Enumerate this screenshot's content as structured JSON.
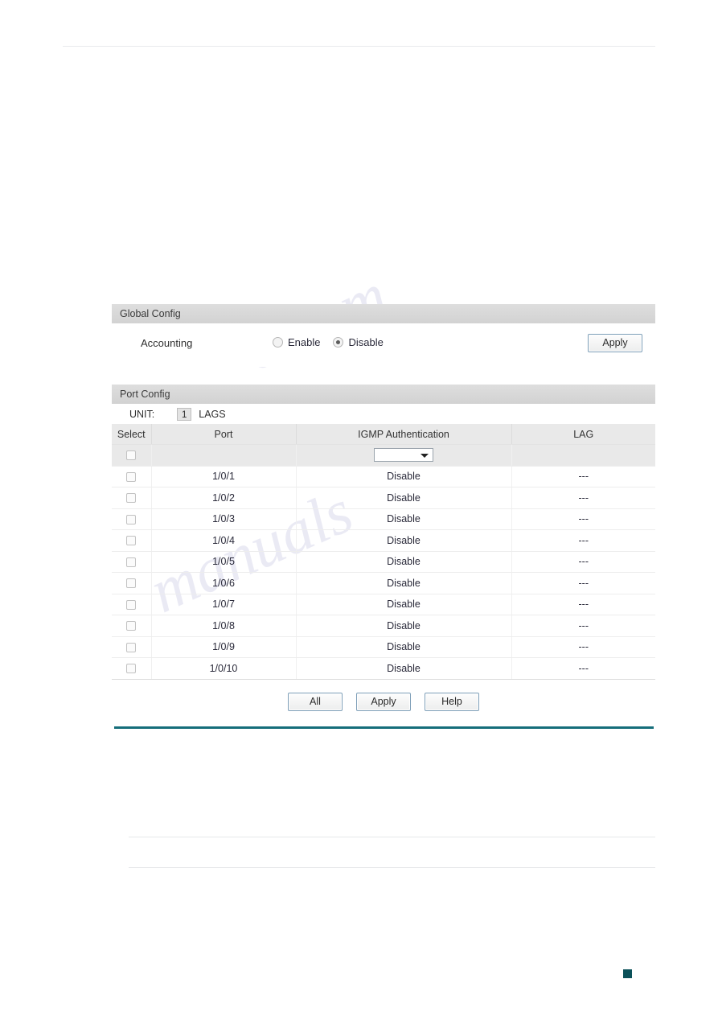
{
  "watermark": {
    "line1": "e.com",
    "line2": "manuals"
  },
  "global_config": {
    "title": "Global Config",
    "accounting_label": "Accounting",
    "options": [
      {
        "label": "Enable",
        "selected": false
      },
      {
        "label": "Disable",
        "selected": true
      }
    ],
    "apply_label": "Apply"
  },
  "port_config": {
    "title": "Port Config",
    "unit_label": "UNIT:",
    "unit_value": "1",
    "lags_label": "LAGS",
    "columns": [
      "Select",
      "Port",
      "IGMP Authentication",
      "LAG"
    ],
    "filter_row": {
      "checkbox_checked": false,
      "port_value": "",
      "igmp_select_value": "",
      "lag_value": ""
    },
    "rows": [
      {
        "checked": false,
        "port": "1/0/1",
        "igmp": "Disable",
        "lag": "---"
      },
      {
        "checked": false,
        "port": "1/0/2",
        "igmp": "Disable",
        "lag": "---"
      },
      {
        "checked": false,
        "port": "1/0/3",
        "igmp": "Disable",
        "lag": "---"
      },
      {
        "checked": false,
        "port": "1/0/4",
        "igmp": "Disable",
        "lag": "---"
      },
      {
        "checked": false,
        "port": "1/0/5",
        "igmp": "Disable",
        "lag": "---"
      },
      {
        "checked": false,
        "port": "1/0/6",
        "igmp": "Disable",
        "lag": "---"
      },
      {
        "checked": false,
        "port": "1/0/7",
        "igmp": "Disable",
        "lag": "---"
      },
      {
        "checked": false,
        "port": "1/0/8",
        "igmp": "Disable",
        "lag": "---"
      },
      {
        "checked": false,
        "port": "1/0/9",
        "igmp": "Disable",
        "lag": "---"
      },
      {
        "checked": false,
        "port": "1/0/10",
        "igmp": "Disable",
        "lag": "---"
      }
    ],
    "buttons": [
      {
        "label": "All"
      },
      {
        "label": "Apply"
      },
      {
        "label": "Help"
      }
    ]
  },
  "colors": {
    "accent_teal": "#156e7a",
    "section_header": "#d6d6d6",
    "table_header": "#e9e9e9"
  }
}
